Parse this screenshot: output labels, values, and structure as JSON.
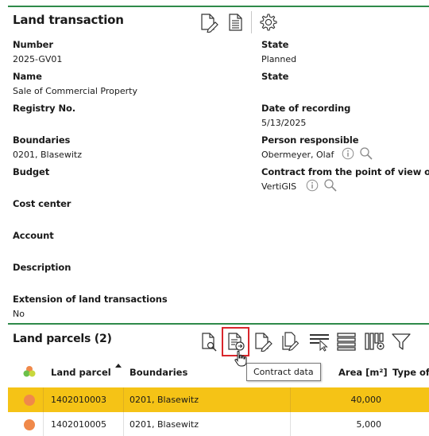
{
  "window": {
    "title": "Land transaction"
  },
  "toolbar": {
    "icons": [
      "edit-document-icon",
      "document-list-icon",
      "gear-icon"
    ]
  },
  "fields": {
    "left": [
      {
        "label": "Number",
        "value": "2025-GV01"
      },
      {
        "label": "Name",
        "value": "Sale of Commercial Property"
      },
      {
        "label": "Registry No.",
        "value": ""
      },
      {
        "label": "Boundaries",
        "value": "0201, Blasewitz"
      },
      {
        "label": "Budget",
        "value": ""
      },
      {
        "label": "Cost center",
        "value": ""
      },
      {
        "label": "Account",
        "value": ""
      },
      {
        "label": "Description",
        "value": ""
      },
      {
        "label": "Extension of land transactions",
        "value": "No"
      }
    ],
    "right": [
      {
        "label": "State",
        "value": "Planned"
      },
      {
        "label": "State",
        "value": ""
      },
      {
        "label": "Date of recording",
        "value": "5/13/2025"
      },
      {
        "label": "Person responsible",
        "value": "Obermeyer, Olaf"
      },
      {
        "label": "Contract from the point of view of",
        "value": "VertiGIS"
      }
    ]
  },
  "parcels": {
    "title": "Land parcels (2)",
    "toolbar_icons": [
      "document-search-icon",
      "contract-data-icon",
      "edit-document-icon",
      "copy-document-icon",
      "select-list-icon",
      "list-icon",
      "column-settings-icon",
      "filter-icon"
    ],
    "tooltip": "Contract data",
    "columns": [
      "Land parcel",
      "Boundaries",
      "Area [m²]",
      "Type of"
    ],
    "rows": [
      {
        "parcel": "1402010003",
        "boundaries": "0201, Blasewitz",
        "area": "40,000"
      },
      {
        "parcel": "1402010005",
        "boundaries": "0201, Blasewitz",
        "area": "5,000"
      }
    ]
  },
  "colors": {
    "accent_line": "#2f8a4a",
    "selected_row": "#f5c316",
    "parcel_dot": "#f0894a",
    "highlight": "#d9262c"
  }
}
